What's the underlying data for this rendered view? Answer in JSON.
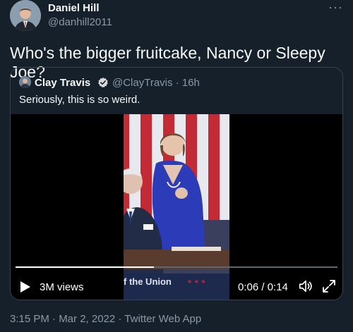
{
  "author": {
    "name": "Daniel Hill",
    "handle": "@danhill2011"
  },
  "more_icon": "more-horizontal-icon",
  "tweet_text": "Who's the bigger fruitcake, Nancy or Sleepy Joe?",
  "quoted": {
    "name": "Clay Travis",
    "verified": true,
    "handle_time": "@ClayTravis · 16h",
    "text": "Seriously, this is so weird."
  },
  "video": {
    "views": "3M views",
    "time": "0:06 / 0:14",
    "progress": 0.43,
    "banner_text": "f the Union",
    "controls": [
      "play-icon",
      "volume-icon",
      "fullscreen-icon"
    ]
  },
  "meta": "3:15 PM · Mar 2, 2022 · Twitter Web App",
  "colors": {
    "background": "#15202b",
    "secondary_text": "#8b98a5",
    "border": "#38444d",
    "verified": "#1d9bf0"
  }
}
